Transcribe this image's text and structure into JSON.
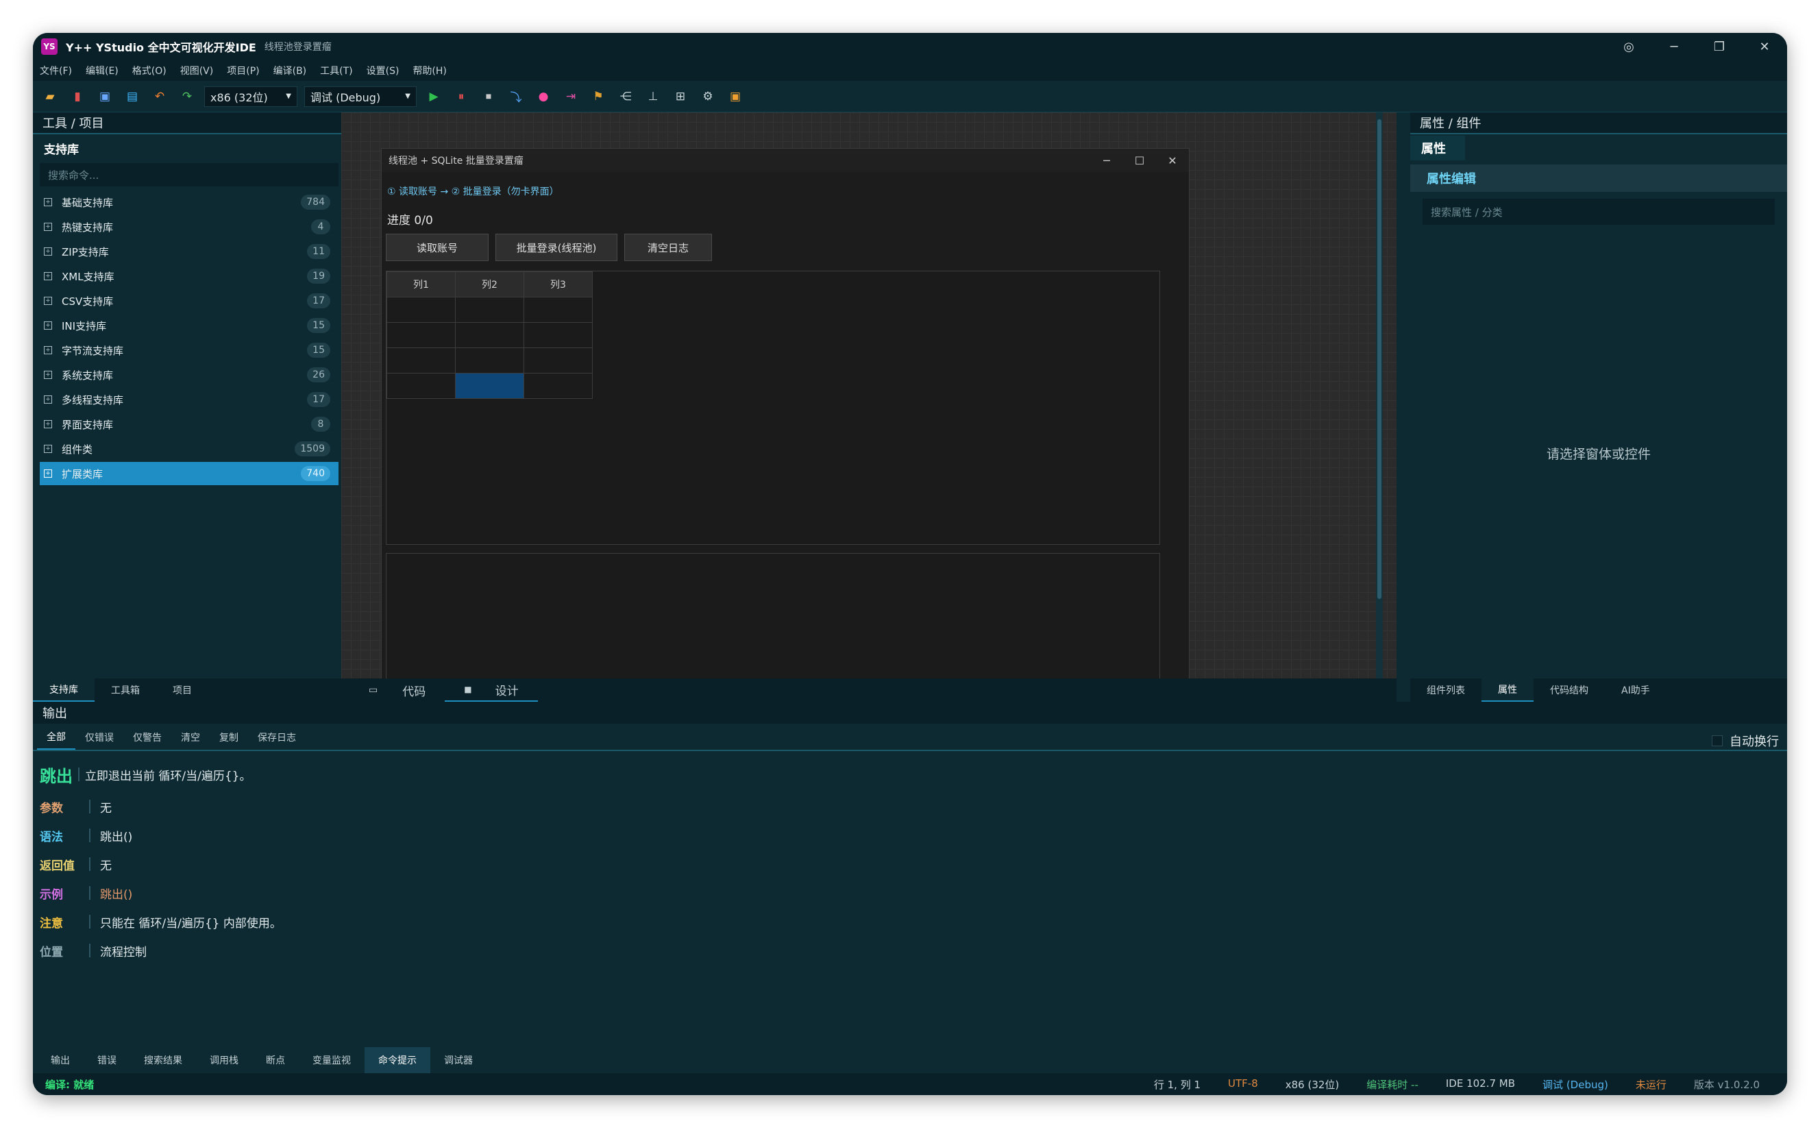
{
  "window": {
    "title": "Y++ YStudio 全中文可视化开发IDE",
    "subtitle": "线程池登录置瘤"
  },
  "menu": [
    "文件(F)",
    "编辑(E)",
    "格式(O)",
    "视图(V)",
    "项目(P)",
    "编译(B)",
    "工具(T)",
    "设置(S)",
    "帮助(H)"
  ],
  "toolbar": {
    "platform": "x86 (32位)",
    "config": "调试 (Debug)"
  },
  "left": {
    "header": "工具 / 项目",
    "section": "支持库",
    "search_placeholder": "搜索命令...",
    "items": [
      {
        "label": "基础支持库",
        "count": "784"
      },
      {
        "label": "热键支持库",
        "count": "4"
      },
      {
        "label": "ZIP支持库",
        "count": "11"
      },
      {
        "label": "XML支持库",
        "count": "19"
      },
      {
        "label": "CSV支持库",
        "count": "17"
      },
      {
        "label": "INI支持库",
        "count": "15"
      },
      {
        "label": "字节流支持库",
        "count": "15"
      },
      {
        "label": "系统支持库",
        "count": "26"
      },
      {
        "label": "多线程支持库",
        "count": "17"
      },
      {
        "label": "界面支持库",
        "count": "8"
      },
      {
        "label": "组件类",
        "count": "1509"
      },
      {
        "label": "扩展类库",
        "count": "740"
      }
    ],
    "tabs": [
      "支持库",
      "工具箱",
      "项目"
    ]
  },
  "form": {
    "title": "线程池 + SQLite 批量登录置瘤",
    "step": "① 读取账号 → ② 批量登录（勿卡界面）",
    "progress": "进度 0/0",
    "buttons": [
      "读取账号",
      "批量登录(线程池)",
      "清空日志"
    ],
    "columns": [
      "列1",
      "列2",
      "列3"
    ]
  },
  "center_tabs": [
    "代码",
    "设计"
  ],
  "right": {
    "header": "属性 / 组件",
    "tab": "属性",
    "section": "属性编辑",
    "search_placeholder": "搜索属性 / 分类",
    "empty": "请选择窗体或控件",
    "tabs": [
      "组件列表",
      "属性",
      "代码结构",
      "AI助手"
    ]
  },
  "output": {
    "header": "输出",
    "tabs": [
      "全部",
      "仅错误",
      "仅警告",
      "清空",
      "复制",
      "保存日志"
    ],
    "autowrap": "自动换行",
    "doc_title": "跳出",
    "doc_desc": "立即退出当前 循环/当/遍历{}。",
    "rows": [
      {
        "k": "参数",
        "v": "无",
        "color": "#e0a070"
      },
      {
        "k": "语法",
        "v": "跳出()",
        "color": "#55c8f0"
      },
      {
        "k": "返回值",
        "v": "无",
        "color": "#e6d070"
      },
      {
        "k": "示例",
        "v": "跳出()",
        "color": "#d070e0"
      },
      {
        "k": "注意",
        "v": "只能在 循环/当/遍历{} 内部使用。",
        "color": "#f0c040"
      },
      {
        "k": "位置",
        "v": "流程控制",
        "color": "#90a8b0"
      }
    ],
    "bottom_tabs": [
      "输出",
      "错误",
      "搜索结果",
      "调用栈",
      "断点",
      "变量监视",
      "命令提示",
      "调试器"
    ]
  },
  "status": {
    "left": "编译: 就绪",
    "pos": "行 1, 列 1",
    "enc": "UTF-8",
    "arch": "x86 (32位)",
    "time": "编译耗时 --",
    "mem": "IDE 102.7 MB",
    "mode": "调试 (Debug)",
    "run": "未运行",
    "ver": "版本 v1.0.2.0"
  }
}
